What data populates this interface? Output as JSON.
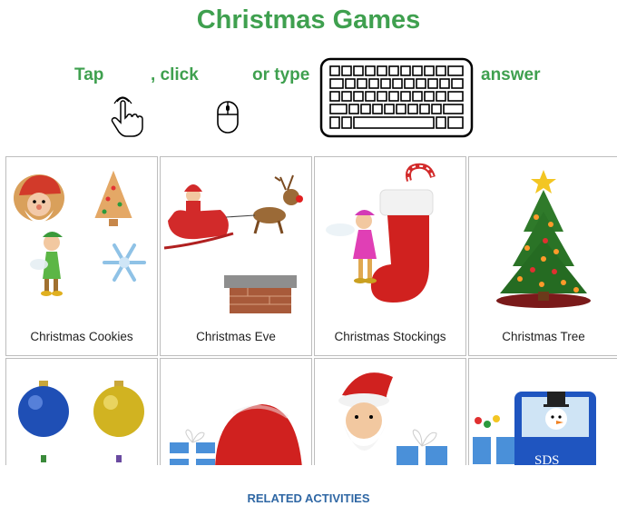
{
  "page": {
    "title": "Christmas Games",
    "related_label": "RELATED ACTIVITIES"
  },
  "instructions": {
    "tap": "Tap",
    "click": ", click",
    "or_type": "or type",
    "answer": "answer"
  },
  "games": [
    {
      "label": "Christmas Cookies"
    },
    {
      "label": "Christmas Eve"
    },
    {
      "label": "Christmas Stockings"
    },
    {
      "label": "Christmas Tree"
    },
    {
      "label": ""
    },
    {
      "label": ""
    },
    {
      "label": ""
    },
    {
      "label": ""
    }
  ],
  "icons": {
    "tap": "hand-tap-icon",
    "click": "mouse-icon",
    "type": "keyboard-icon"
  },
  "colors": {
    "title_green": "#3fa04f",
    "related_blue": "#2f67a4"
  }
}
